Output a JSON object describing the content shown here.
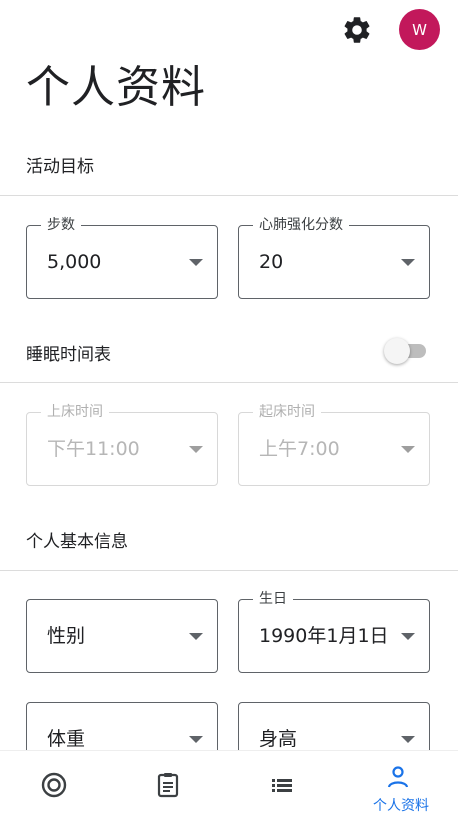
{
  "header": {
    "avatar_initial": "W"
  },
  "page": {
    "title": "个人资料"
  },
  "activity_goals": {
    "title": "活动目标",
    "steps": {
      "label": "步数",
      "value": "5,000"
    },
    "cardio": {
      "label": "心肺强化分数",
      "value": "20"
    }
  },
  "sleep_schedule": {
    "title": "睡眠时间表",
    "toggle_on": false,
    "bedtime": {
      "label": "上床时间",
      "value": "下午11:00"
    },
    "wake": {
      "label": "起床时间",
      "value": "上午7:00"
    }
  },
  "basic_info": {
    "title": "个人基本信息",
    "gender": {
      "label": "",
      "value": "性别"
    },
    "birthday": {
      "label": "生日",
      "value": "1990年1月1日"
    },
    "weight": {
      "label": "",
      "value": "体重"
    },
    "height": {
      "label": "",
      "value": "身高"
    }
  },
  "bottom_nav": {
    "items": [
      {
        "icon": "activity-ring-icon"
      },
      {
        "icon": "clipboard-icon"
      },
      {
        "icon": "list-icon"
      },
      {
        "icon": "profile-icon",
        "label": "个人资料",
        "active": true
      }
    ]
  },
  "colors": {
    "accent": "#1a73e8",
    "avatar": "#c2185b"
  }
}
